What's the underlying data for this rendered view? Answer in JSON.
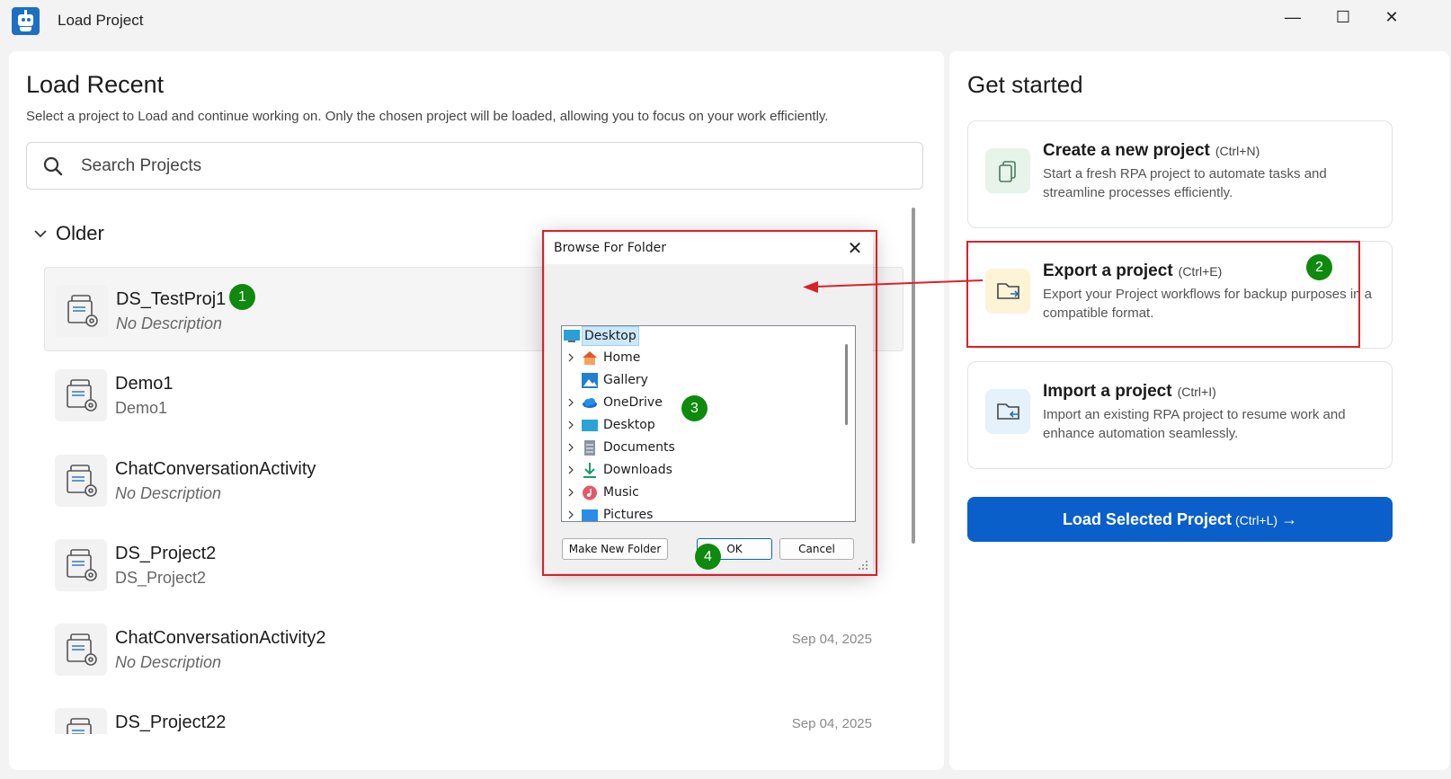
{
  "window": {
    "title": "Load Project",
    "minimize": "—",
    "maximize": "☐",
    "close": "✕"
  },
  "load_recent": {
    "title": "Load Recent",
    "subtitle": "Select a project to Load and continue working on. Only the chosen project will be loaded, allowing you to focus on your work efficiently.",
    "search_placeholder": "Search Projects",
    "group": "Older",
    "projects": [
      {
        "name": "DS_TestProj1",
        "description": "No Description",
        "date": ""
      },
      {
        "name": "Demo1",
        "description": "Demo1",
        "date": ""
      },
      {
        "name": "ChatConversationActivity",
        "description": "No Description",
        "date": ""
      },
      {
        "name": "DS_Project2",
        "description": "DS_Project2",
        "date": ""
      },
      {
        "name": "ChatConversationActivity2",
        "description": "No Description",
        "date": "Sep 04, 2025"
      },
      {
        "name": "DS_Project22",
        "description": "",
        "date": "Sep 04, 2025"
      }
    ]
  },
  "get_started": {
    "title": "Get started",
    "cards": [
      {
        "title": "Create a new project",
        "shortcut": "(Ctrl+N)",
        "description": "Start a fresh RPA project to automate tasks and streamline processes efficiently.",
        "icon": "new-project-icon",
        "color": "#e6f4ea"
      },
      {
        "title": "Export a project",
        "shortcut": "(Ctrl+E)",
        "description": "Export your Project workflows for backup purposes in a compatible format.",
        "icon": "export-icon",
        "color": "#fdf3d7"
      },
      {
        "title": "Import a project",
        "shortcut": "(Ctrl+I)",
        "description": "Import an existing RPA project to resume work and enhance automation seamlessly.",
        "icon": "import-icon",
        "color": "#e5f1fb"
      }
    ],
    "load_button": {
      "label": "Load Selected Project",
      "shortcut": "(Ctrl+L)",
      "arrow": "→"
    }
  },
  "dialog": {
    "title": "Browse For Folder",
    "close": "✕",
    "tree": [
      {
        "label": "Desktop",
        "icon": "desktop-icon",
        "expandable": false,
        "selected": true
      },
      {
        "label": "Home",
        "icon": "home-icon",
        "expandable": true
      },
      {
        "label": "Gallery",
        "icon": "gallery-icon",
        "expandable": false
      },
      {
        "label": "OneDrive",
        "icon": "onedrive-icon",
        "expandable": true
      },
      {
        "label": "Desktop",
        "icon": "desktop-icon",
        "expandable": true
      },
      {
        "label": "Documents",
        "icon": "documents-icon",
        "expandable": true
      },
      {
        "label": "Downloads",
        "icon": "downloads-icon",
        "expandable": true
      },
      {
        "label": "Music",
        "icon": "music-icon",
        "expandable": true
      },
      {
        "label": "Pictures",
        "icon": "pictures-icon",
        "expandable": true
      }
    ],
    "buttons": {
      "new_folder": "Make New Folder",
      "ok": "OK",
      "cancel": "Cancel"
    }
  },
  "annotations": {
    "badges": [
      "1",
      "2",
      "3",
      "4"
    ],
    "color": "#d8222a",
    "badge_color": "#0e8a0e"
  },
  "colors": {
    "accent": "#0a5fcb",
    "background": "#f3f3f3"
  }
}
